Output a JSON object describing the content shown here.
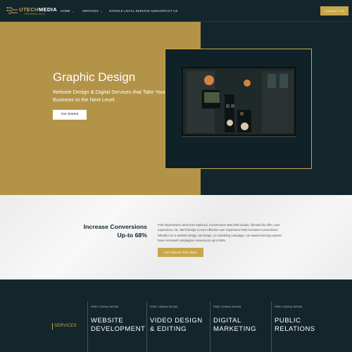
{
  "brand": {
    "name_part1": "UTECH",
    "name_part2": "MEDIA",
    "tagline": "TECHNOLOGY"
  },
  "nav": {
    "items": [
      {
        "label": "HOME",
        "caret": "⌄"
      },
      {
        "label": "SERVICES",
        "caret": "⌄"
      },
      {
        "label": "GOOGLE LOCAL SERVICE ADS"
      },
      {
        "label": "CONTACT US"
      }
    ],
    "cta": "CONTACT US"
  },
  "hero": {
    "title": "Graphic Design",
    "subtitle": "Website Design & Digital Services that Take Your Business to the Next Level.",
    "button": "Get Started"
  },
  "conversions": {
    "title_line1": "Increase Conversions",
    "title_line2": "Up-to 68%",
    "body": "First Impressions cannot be replaced.  Conversions start with visuals, followed by offer, user experience, etc. We'll design a more effective user experience that increases conversions.  Whether it's a website design, ad design, or marketing campaign, our award-winning experts have increased campaigns conversions up to 68%.",
    "button": "Let's Discuss Your Vision"
  },
  "services": {
    "label": "SERVICES",
    "items": [
      {
        "kicker": "FREE CONSULTATION",
        "line1": "WEBSITE",
        "line2": "DEVELOPMENT"
      },
      {
        "kicker": "FREE CONSULTATION",
        "line1": "VIDEO DESIGN",
        "line2": "& EDITING"
      },
      {
        "kicker": "FREE CONSULTATION",
        "line1": "DIGITAL",
        "line2": "MARKETING"
      },
      {
        "kicker": "FREE CONSULTATION",
        "line1": "PUBLIC",
        "line2": "RELATIONS"
      }
    ]
  },
  "colors": {
    "navy": "#13262b",
    "gold": "#b39348",
    "accent": "#c8a74a"
  }
}
